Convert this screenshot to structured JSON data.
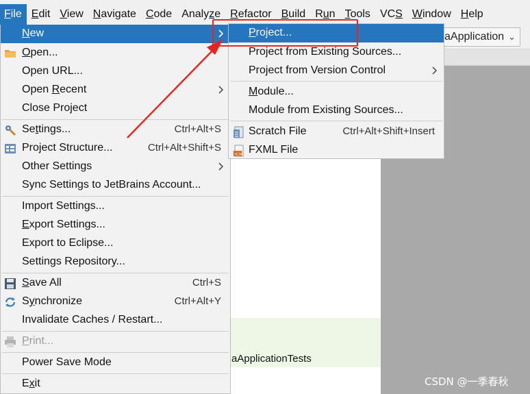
{
  "menubar": {
    "items": [
      {
        "label": "File",
        "mnemonic": "F"
      },
      {
        "label": "Edit",
        "mnemonic": "E"
      },
      {
        "label": "View",
        "mnemonic": "V"
      },
      {
        "label": "Navigate",
        "mnemonic": "N"
      },
      {
        "label": "Code",
        "mnemonic": "C"
      },
      {
        "label": "Analyze",
        "mnemonic": "z"
      },
      {
        "label": "Refactor",
        "mnemonic": "R"
      },
      {
        "label": "Build",
        "mnemonic": "B"
      },
      {
        "label": "Run",
        "mnemonic": "u"
      },
      {
        "label": "Tools",
        "mnemonic": "T"
      },
      {
        "label": "VCS",
        "mnemonic": "S"
      },
      {
        "label": "Window",
        "mnemonic": "W"
      },
      {
        "label": "Help",
        "mnemonic": "H"
      }
    ]
  },
  "file_menu": {
    "items": [
      {
        "label": "New",
        "mnemonic": "N",
        "submenu": true,
        "selected": true
      },
      {
        "label": "Open...",
        "mnemonic": "O",
        "icon": "folder-icon"
      },
      {
        "label": "Open URL...",
        "mnemonic": ""
      },
      {
        "label": "Open Recent",
        "mnemonic": "R",
        "submenu": true
      },
      {
        "label": "Close Project",
        "mnemonic": ""
      },
      {
        "label": "Settings...",
        "mnemonic": "t",
        "shortcut": "Ctrl+Alt+S",
        "icon": "wrench-icon"
      },
      {
        "label": "Project Structure...",
        "mnemonic": "",
        "shortcut": "Ctrl+Alt+Shift+S",
        "icon": "project-structure-icon"
      },
      {
        "label": "Other Settings",
        "mnemonic": "",
        "submenu": true
      },
      {
        "label": "Sync Settings to JetBrains Account...",
        "mnemonic": ""
      },
      {
        "label": "Import Settings...",
        "mnemonic": ""
      },
      {
        "label": "Export Settings...",
        "mnemonic": "E"
      },
      {
        "label": "Export to Eclipse...",
        "mnemonic": ""
      },
      {
        "label": "Settings Repository...",
        "mnemonic": ""
      },
      {
        "label": "Save All",
        "mnemonic": "S",
        "shortcut": "Ctrl+S",
        "icon": "save-icon"
      },
      {
        "label": "Synchronize",
        "mnemonic": "y",
        "shortcut": "Ctrl+Alt+Y",
        "icon": "sync-icon"
      },
      {
        "label": "Invalidate Caches / Restart...",
        "mnemonic": ""
      },
      {
        "label": "Print...",
        "mnemonic": "P",
        "icon": "printer-icon",
        "disabled": true
      },
      {
        "label": "Power Save Mode",
        "mnemonic": ""
      },
      {
        "label": "Exit",
        "mnemonic": "x"
      }
    ]
  },
  "new_submenu": {
    "items": [
      {
        "label": "Project...",
        "mnemonic": "P",
        "selected": true
      },
      {
        "label": "Project from Existing Sources..."
      },
      {
        "label": "Project from Version Control",
        "submenu": true
      },
      {
        "label": "Module...",
        "mnemonic": "M"
      },
      {
        "label": "Module from Existing Sources..."
      },
      {
        "label": "Scratch File",
        "shortcut": "Ctrl+Alt+Shift+Insert",
        "icon": "scratch-file-icon"
      },
      {
        "label": "FXML File",
        "icon": "fxml-file-icon"
      }
    ]
  },
  "background": {
    "run_config_label": "aApplication",
    "test_label": "aApplicationTests",
    "watermark": "CSDN @一季春秋"
  },
  "colors": {
    "selection": "#2675bf",
    "highlight": "#e5261f",
    "menu_bg": "#f2f2f2"
  }
}
